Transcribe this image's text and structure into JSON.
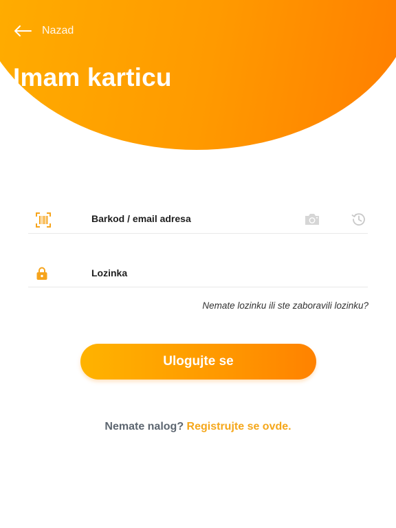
{
  "header": {
    "back_label": "Nazad",
    "title": "Imam karticu",
    "back_icon": "arrow-left-icon"
  },
  "form": {
    "barcode_placeholder": "Barkod / email adresa",
    "password_placeholder": "Lozinka",
    "barcode_icon": "barcode-icon",
    "password_icon": "lock-icon",
    "camera_icon": "camera-icon",
    "history_icon": "history-icon",
    "forgot_link": "Nemate lozinku ili ste zaboravili lozinku?",
    "login_button": "Ulogujte se"
  },
  "footer": {
    "register_question": "Nemate nalog?",
    "register_link": "Registrujte se ovde."
  },
  "colors": {
    "accent": "#ff9a00",
    "accent_light": "#ffb000",
    "accent_dark": "#ff7c00",
    "link": "#f5a71a",
    "icon_gray": "#d6d6d6"
  }
}
